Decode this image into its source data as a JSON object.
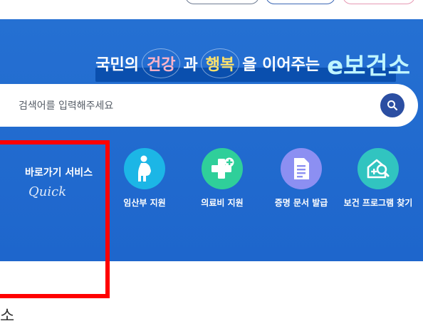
{
  "banner": {
    "slogan": {
      "part1": "국민의",
      "word_health": "건강",
      "part2": "과",
      "word_happiness": "행복",
      "part3": "을 이어주는",
      "brand": "e보건소"
    }
  },
  "search": {
    "placeholder": "검색어를 입력해주세요",
    "icon": "search-icon"
  },
  "quick_menu": {
    "label": "바로가기 서비스",
    "script_label": "Quick",
    "items": [
      {
        "label": "임산부 지원",
        "icon": "pregnant-woman-icon",
        "color": "#1cb6e6"
      },
      {
        "label": "의료비 지원",
        "icon": "medical-cross-plus-icon",
        "color": "#2fcf9a"
      },
      {
        "label": "증명 문서 발급",
        "icon": "document-icon",
        "color": "#8c8ff2"
      },
      {
        "label": "보건 프로그램 찾기",
        "icon": "health-program-search-icon",
        "color": "#31c4c0"
      }
    ]
  },
  "below": {
    "partial_text": "소"
  },
  "colors": {
    "banner": "#2570d2",
    "search_button": "#2b4ea2",
    "highlight_frame": "#ff0000"
  }
}
